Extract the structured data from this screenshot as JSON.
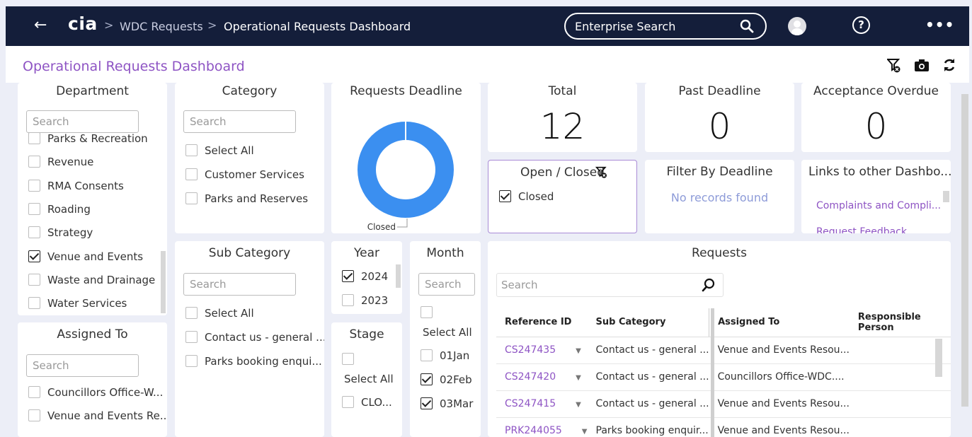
{
  "topbar": {
    "back_icon": "arrow-left-icon",
    "logo": "cia",
    "crumb_sep": ">",
    "breadcrumb": [
      "WDC Requests",
      "Operational Requests Dashboard"
    ],
    "search_label": "Enterprise Search",
    "help_glyph": "?",
    "more_glyph": "•••"
  },
  "page": {
    "title": "Operational Requests Dashboard",
    "icons": [
      "clear-filters-icon",
      "camera-icon",
      "refresh-icon"
    ]
  },
  "department": {
    "title": "Department",
    "search_placeholder": "Search",
    "items": [
      {
        "label": "Parks & Recreation",
        "checked": false
      },
      {
        "label": "Revenue",
        "checked": false
      },
      {
        "label": "RMA Consents",
        "checked": false
      },
      {
        "label": "Roading",
        "checked": false
      },
      {
        "label": "Strategy",
        "checked": false
      },
      {
        "label": "Venue and Events",
        "checked": true
      },
      {
        "label": "Waste and Drainage",
        "checked": false
      },
      {
        "label": "Water Services",
        "checked": false
      }
    ]
  },
  "assigned_to": {
    "title": "Assigned To",
    "search_placeholder": "Search",
    "items": [
      {
        "label": "Councillors Office-W...",
        "checked": false
      },
      {
        "label": "Venue and Events Re...",
        "checked": false
      }
    ]
  },
  "category": {
    "title": "Category",
    "search_placeholder": "Search",
    "items": [
      {
        "label": "Select All",
        "checked": false
      },
      {
        "label": "Customer Services",
        "checked": false
      },
      {
        "label": "Parks and Reserves",
        "checked": false
      }
    ]
  },
  "sub_category": {
    "title": "Sub Category",
    "search_placeholder": "Search",
    "items": [
      {
        "label": "Select All",
        "checked": false
      },
      {
        "label": "Contact us - general ...",
        "checked": false
      },
      {
        "label": "Parks booking enqui...",
        "checked": false
      }
    ]
  },
  "deadline_chart": {
    "title": "Requests Deadline",
    "chart_data": {
      "type": "pie",
      "labels": [
        "Closed"
      ],
      "values": [
        12
      ],
      "colors": [
        "#3b8ff0"
      ]
    }
  },
  "year": {
    "title": "Year",
    "items": [
      {
        "label": "2024",
        "checked": true
      },
      {
        "label": "2023",
        "checked": false
      }
    ]
  },
  "month": {
    "title": "Month",
    "search_placeholder": "Search",
    "items": [
      {
        "label": "Select All",
        "checked": false
      },
      {
        "label": "01Jan",
        "checked": false
      },
      {
        "label": "02Feb",
        "checked": true
      },
      {
        "label": "03Mar",
        "checked": true
      }
    ]
  },
  "stage": {
    "title": "Stage",
    "items": [
      {
        "label": "Select All",
        "checked": false
      },
      {
        "label": "CLO...",
        "checked": false
      }
    ]
  },
  "kpis": {
    "total": {
      "title": "Total",
      "value": "12"
    },
    "past_deadline": {
      "title": "Past Deadline",
      "value": "0"
    },
    "acceptance_overdue": {
      "title": "Acceptance Overdue",
      "value": "0"
    }
  },
  "open_closed": {
    "title": "Open / Closed",
    "items": [
      {
        "label": "Closed",
        "checked": true
      }
    ]
  },
  "filter_by_deadline": {
    "title": "Filter By Deadline",
    "empty_text": "No records found"
  },
  "links": {
    "title": "Links to other Dashbo...",
    "items": [
      "Complaints and Compli...",
      "Request Feedback"
    ]
  },
  "requests": {
    "title": "Requests",
    "search_placeholder": "Search",
    "columns": [
      "Reference ID",
      "Sub Category",
      "Assigned To",
      "Responsible Person"
    ],
    "rows": [
      {
        "ref": "CS247435",
        "sub": "Contact us - general ...",
        "assigned": "Venue and Events Resou...",
        "person": ""
      },
      {
        "ref": "CS247420",
        "sub": "Contact us - general ...",
        "assigned": "Councillors Office-WDC....",
        "person": ""
      },
      {
        "ref": "CS247415",
        "sub": "Contact us - general ...",
        "assigned": "Venue and Events Resou...",
        "person": ""
      },
      {
        "ref": "PRK244055",
        "sub": "Parks booking enquir...",
        "assigned": "Venue and Events Resou...",
        "person": ""
      }
    ]
  },
  "colors": {
    "topbar": "#141e3a",
    "accent_purple": "#8e54c4",
    "donut_blue": "#3b8ff0",
    "background": "#eceef7"
  }
}
